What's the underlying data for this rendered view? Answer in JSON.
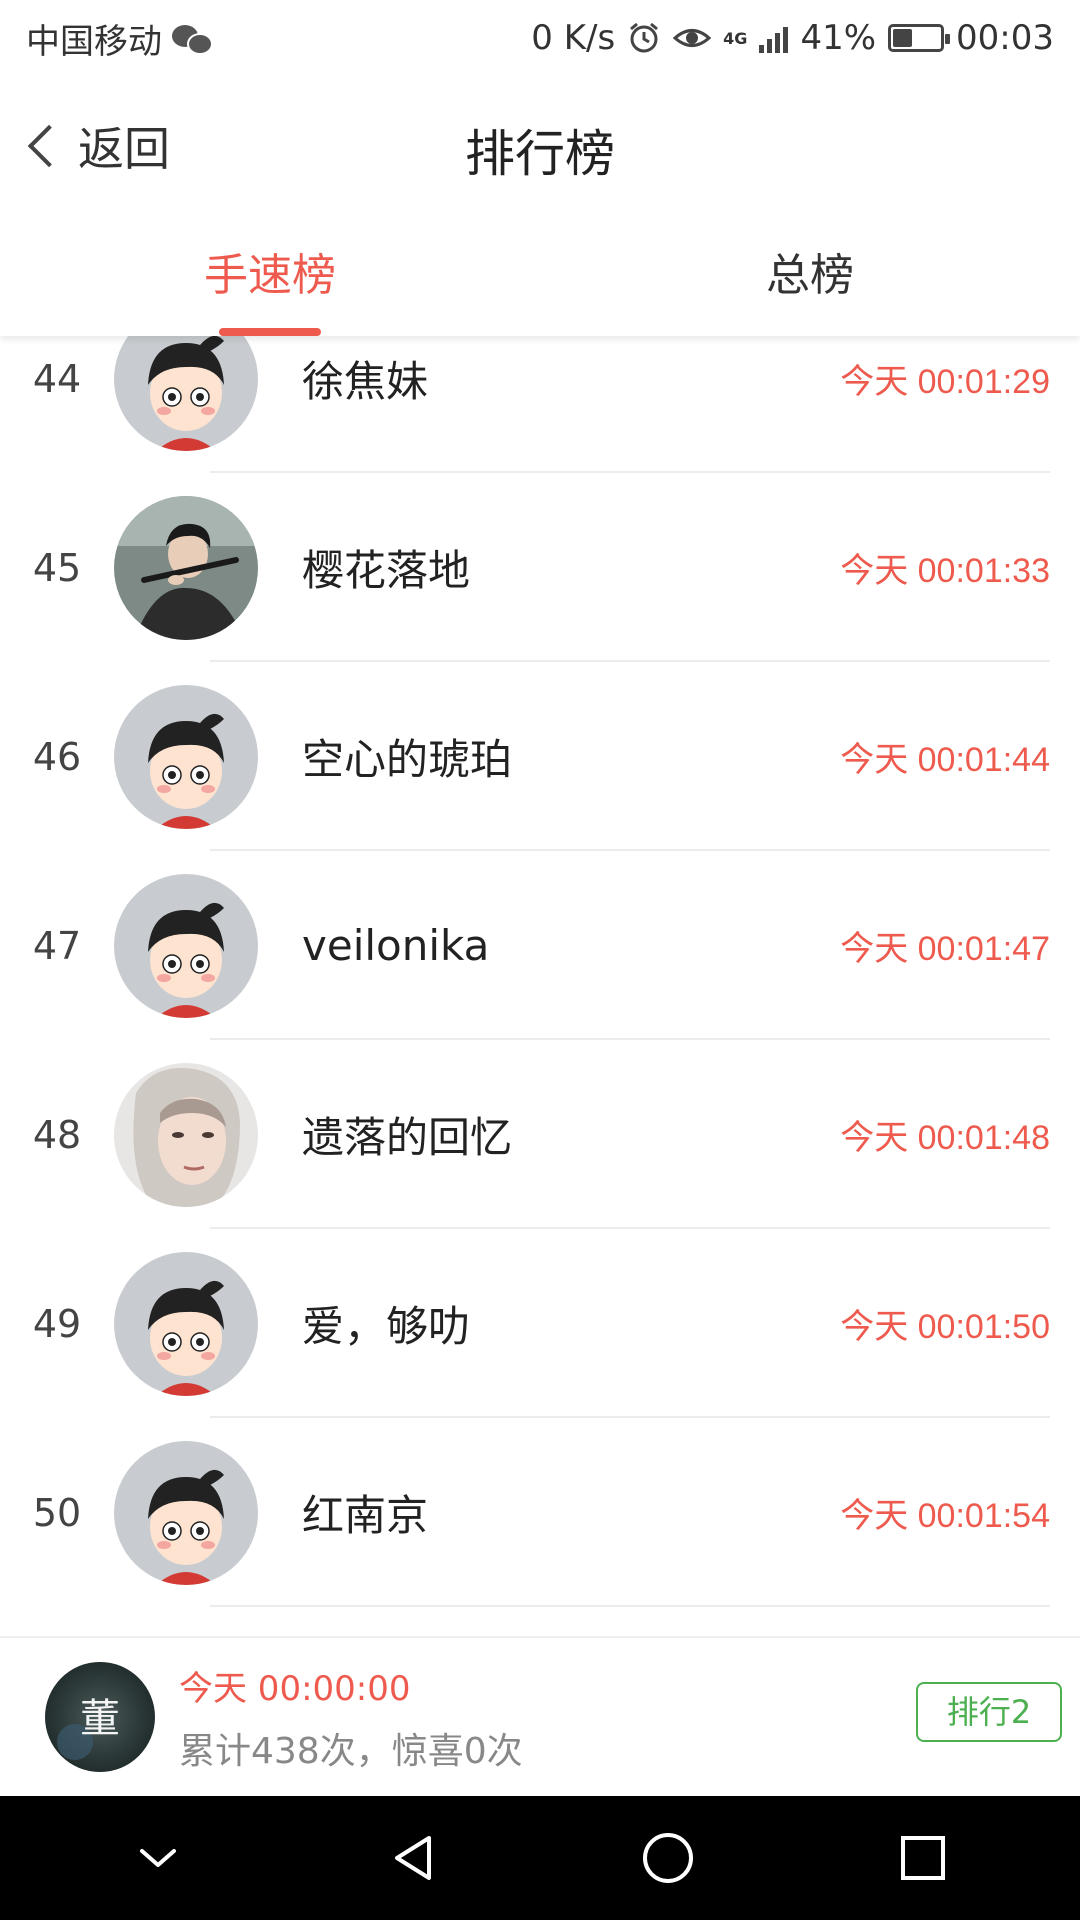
{
  "status_bar": {
    "carrier": "中国移动",
    "net_speed": "0 K/s",
    "network": "4G",
    "battery": "41%",
    "battery_level": 0.41,
    "time": "00:03"
  },
  "header": {
    "back_label": "返回",
    "title": "排行榜"
  },
  "tabs": [
    {
      "label": "手速榜",
      "active": true
    },
    {
      "label": "总榜",
      "active": false
    }
  ],
  "list": [
    {
      "rank": "44",
      "name": "徐焦妹",
      "time": "今天 00:01:29",
      "avatar": "cartoon-boy"
    },
    {
      "rank": "45",
      "name": "樱花落地",
      "time": "今天 00:01:33",
      "avatar": "photo-man"
    },
    {
      "rank": "46",
      "name": "空心的琥珀",
      "time": "今天 00:01:44",
      "avatar": "cartoon-boy"
    },
    {
      "rank": "47",
      "name": "veilonika",
      "time": "今天 00:01:47",
      "avatar": "cartoon-boy"
    },
    {
      "rank": "48",
      "name": "遗落的回忆",
      "time": "今天 00:01:48",
      "avatar": "photo-woman"
    },
    {
      "rank": "49",
      "name": "爱，够叻",
      "time": "今天 00:01:50",
      "avatar": "cartoon-boy"
    },
    {
      "rank": "50",
      "name": "红南京",
      "time": "今天 00:01:54",
      "avatar": "cartoon-boy"
    }
  ],
  "my_record": {
    "avatar_text": "董",
    "time": "今天 00:00:00",
    "stats": "累计438次，惊喜0次",
    "rank_button": "排行2"
  },
  "colors": {
    "accent": "#ee5b4e",
    "rank_button": "#4caf50"
  },
  "nav_icons": [
    "chevron-down-icon",
    "back-triangle-icon",
    "home-circle-icon",
    "recents-square-icon"
  ]
}
